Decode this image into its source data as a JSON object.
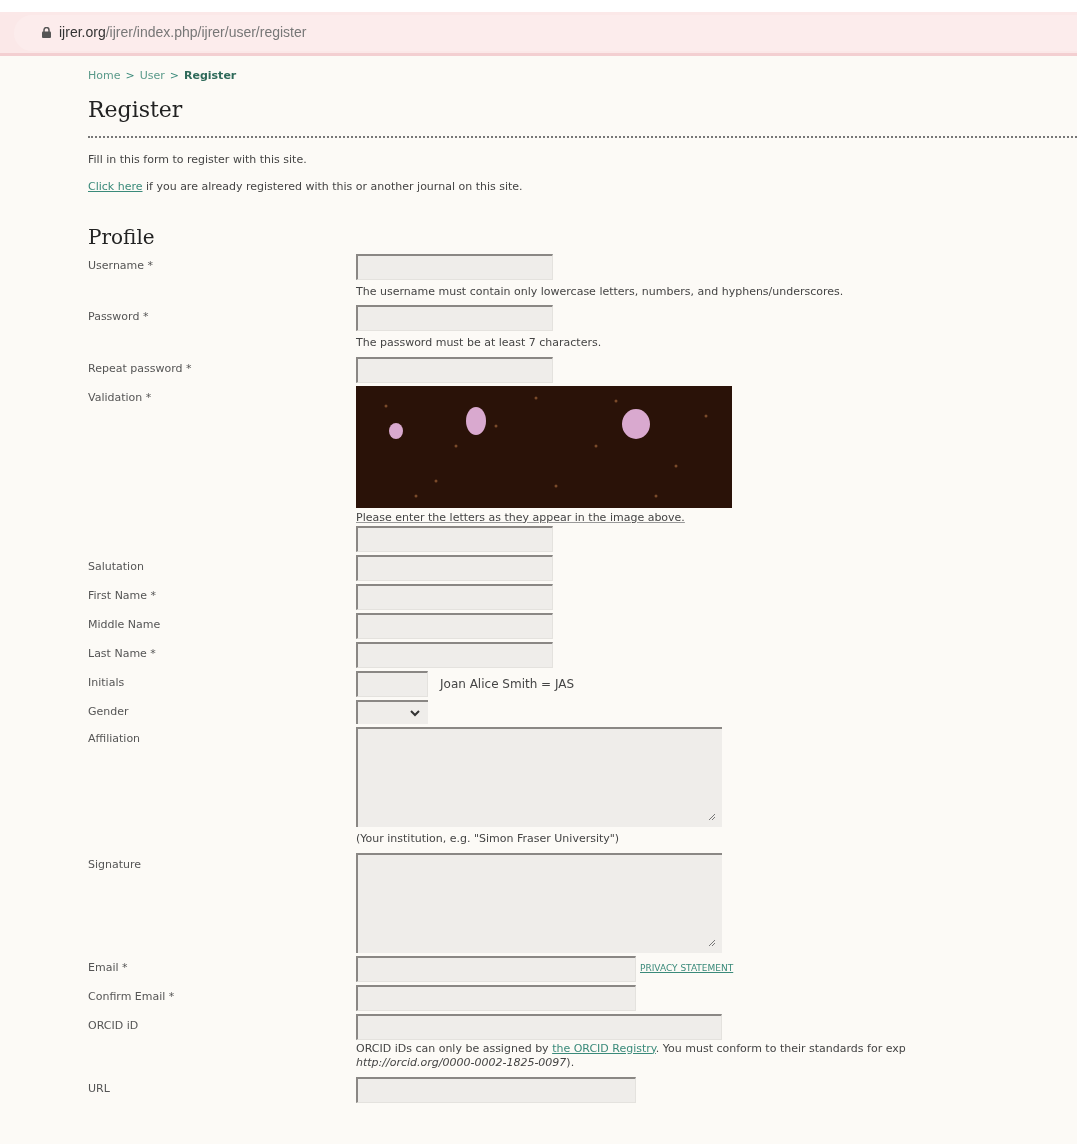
{
  "address_bar": {
    "domain": "ijrer.org",
    "path": "/ijrer/index.php/ijrer/user/register"
  },
  "breadcrumb": [
    {
      "label": "Home",
      "current": false
    },
    {
      "label": "User",
      "current": false
    },
    {
      "label": "Register",
      "current": true
    }
  ],
  "breadcrumb_separator": ">",
  "title": "Register",
  "intro": "Fill in this form to register with this site.",
  "login_note": {
    "link": "Click here",
    "text": " if you are already registered with this or another journal on this site."
  },
  "section": "Profile",
  "fields": [
    {
      "kind": "text",
      "label": "Username *",
      "hint": "The username must contain only lowercase letters, numbers, and hyphens/underscores."
    },
    {
      "kind": "text",
      "label": "Password *",
      "hint": "The password must be at least 7 characters."
    },
    {
      "kind": "text",
      "label": "Repeat password *"
    },
    {
      "kind": "captcha",
      "label": "Validation *",
      "hint": "Please enter the letters as they appear in the image above."
    },
    {
      "kind": "text",
      "label": "Salutation"
    },
    {
      "kind": "text",
      "label": "First Name *"
    },
    {
      "kind": "text",
      "label": "Middle Name"
    },
    {
      "kind": "text",
      "label": "Last Name *"
    },
    {
      "kind": "short_text",
      "label": "Initials",
      "side": "Joan Alice Smith = JAS"
    },
    {
      "kind": "select",
      "label": "Gender"
    },
    {
      "kind": "textarea",
      "label": "Affiliation",
      "hint": "(Your institution, e.g. \"Simon Fraser University\")"
    },
    {
      "kind": "textarea",
      "label": "Signature"
    },
    {
      "kind": "wide_text",
      "label": "Email *",
      "side_link": "PRIVACY STATEMENT"
    },
    {
      "kind": "wide_text",
      "label": "Confirm Email *"
    },
    {
      "kind": "orcid",
      "label": "ORCID iD",
      "hint_before": "ORCID iDs can only be assigned by ",
      "hint_link": "the ORCID Registry",
      "hint_after": ". You must conform to their standards for exp",
      "hint_line2": "*http://orcid.org/0000-0002-1825-0097*)."
    },
    {
      "kind": "wide_text",
      "label": "URL"
    }
  ]
}
